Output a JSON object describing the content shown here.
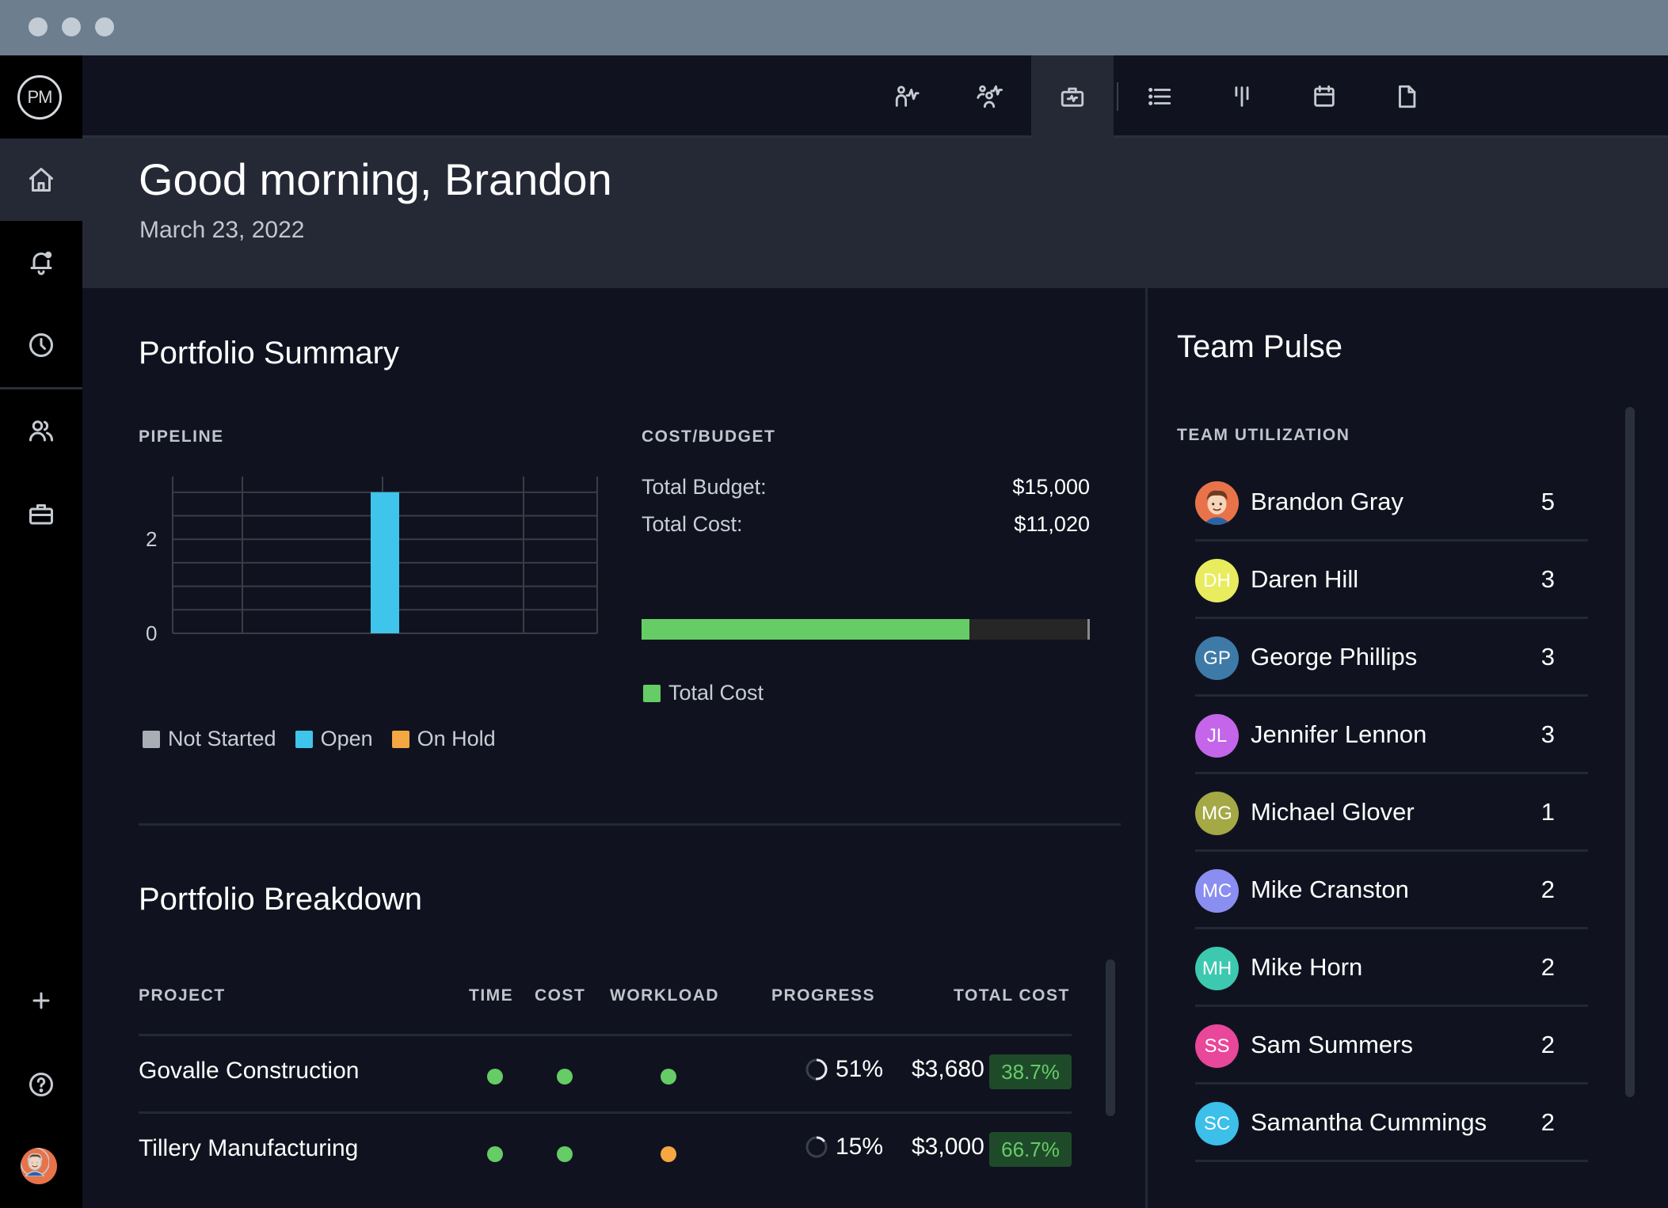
{
  "window": {
    "controls": [
      "close",
      "minimize",
      "maximize"
    ]
  },
  "app": {
    "logo_text": "PM"
  },
  "rail": {
    "items": [
      {
        "name": "home",
        "icon": "home-icon",
        "active": true
      },
      {
        "name": "notifications",
        "icon": "bell-icon",
        "active": false
      },
      {
        "name": "recent",
        "icon": "clock-icon",
        "active": false
      },
      {
        "name": "people",
        "icon": "users-icon",
        "active": false
      },
      {
        "name": "portfolio",
        "icon": "briefcase-icon",
        "active": false
      }
    ],
    "bottom": [
      {
        "name": "add",
        "icon": "plus-icon"
      },
      {
        "name": "help",
        "icon": "help-icon"
      },
      {
        "name": "profile",
        "icon": "user-avatar"
      }
    ]
  },
  "toolbar": {
    "items": [
      {
        "name": "my-dashboard",
        "icon": "person-pulse-icon",
        "active": false
      },
      {
        "name": "team-dashboard",
        "icon": "team-pulse-icon",
        "active": false
      },
      {
        "name": "portfolio-dashboard",
        "icon": "briefcase-pulse-icon",
        "active": true
      },
      {
        "name": "list-view",
        "icon": "list-icon",
        "active": false
      },
      {
        "name": "board-view",
        "icon": "board-icon",
        "active": false
      },
      {
        "name": "calendar-view",
        "icon": "calendar-icon",
        "active": false
      },
      {
        "name": "documents",
        "icon": "document-icon",
        "active": false
      }
    ]
  },
  "header": {
    "greeting": "Good morning, Brandon",
    "date": "March 23, 2022"
  },
  "portfolio_summary": {
    "title": "Portfolio Summary",
    "pipeline_label": "PIPELINE",
    "cost_budget_label": "COST/BUDGET",
    "total_budget_label": "Total Budget:",
    "total_budget_value": "$15,000",
    "total_cost_label": "Total Cost:",
    "total_cost_value": "$11,020",
    "cost_fraction": 0.7347,
    "cost_legend": "Total Cost",
    "colors": {
      "cost": "#66cc66",
      "not_started": "#a9adb5",
      "open": "#3fc5ec",
      "on_hold": "#f5a742"
    }
  },
  "chart_data": {
    "type": "bar",
    "title": "PIPELINE",
    "categories": [
      "Not Started",
      "Open",
      "On Hold"
    ],
    "series": [
      {
        "name": "Not Started",
        "values": [
          0,
          0,
          0
        ],
        "color": "#a9adb5"
      },
      {
        "name": "Open",
        "values": [
          0,
          3,
          0
        ],
        "color": "#3fc5ec"
      },
      {
        "name": "On Hold",
        "values": [
          0,
          0,
          0
        ],
        "color": "#f5a742"
      }
    ],
    "yticks": [
      "0",
      "2"
    ],
    "ylim": [
      0,
      3.3
    ],
    "grid": true,
    "legend": "bottom",
    "xlabel": "",
    "ylabel": ""
  },
  "portfolio_breakdown": {
    "title": "Portfolio Breakdown",
    "columns": [
      "PROJECT",
      "TIME",
      "COST",
      "WORKLOAD",
      "PROGRESS",
      "TOTAL COST"
    ],
    "rows": [
      {
        "project": "Govalle Construction",
        "time": "green",
        "cost": "green",
        "workload": "green",
        "progress": "51%",
        "progress_value": 0.51,
        "total_cost": "$3,680",
        "percent": "38.7%"
      },
      {
        "project": "Tillery Manufacturing",
        "time": "green",
        "cost": "green",
        "workload": "orange",
        "progress": "15%",
        "progress_value": 0.15,
        "total_cost": "$3,000",
        "percent": "66.7%"
      }
    ],
    "status_colors": {
      "green": "#66cc66",
      "orange": "#f5a742"
    }
  },
  "team_pulse": {
    "title": "Team Pulse",
    "utilization_label": "TEAM UTILIZATION",
    "members": [
      {
        "name": "Brandon Gray",
        "initials": "",
        "count": "5",
        "color": "#e8734a",
        "photo": true
      },
      {
        "name": "Daren Hill",
        "initials": "DH",
        "count": "3",
        "color": "#e8ec5e"
      },
      {
        "name": "George Phillips",
        "initials": "GP",
        "count": "3",
        "color": "#3e7aa8"
      },
      {
        "name": "Jennifer Lennon",
        "initials": "JL",
        "count": "3",
        "color": "#c465ea"
      },
      {
        "name": "Michael Glover",
        "initials": "MG",
        "count": "1",
        "color": "#a4a845"
      },
      {
        "name": "Mike Cranston",
        "initials": "MC",
        "count": "2",
        "color": "#8a8ef0"
      },
      {
        "name": "Mike Horn",
        "initials": "MH",
        "count": "2",
        "color": "#3cc9b0"
      },
      {
        "name": "Sam Summers",
        "initials": "SS",
        "count": "2",
        "color": "#e8479a"
      },
      {
        "name": "Samantha Cummings",
        "initials": "SC",
        "count": "2",
        "color": "#3cbfe8"
      }
    ]
  }
}
